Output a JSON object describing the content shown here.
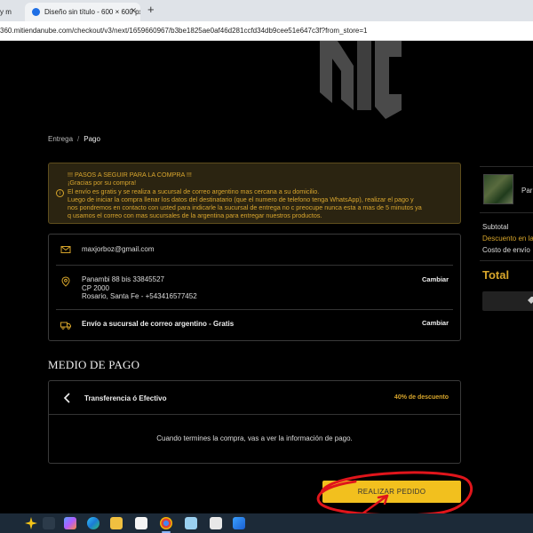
{
  "browser": {
    "tabs": [
      {
        "title": "y m"
      },
      {
        "title": "Diseño sin título - 600 × 600 px"
      }
    ],
    "new_tab": "+",
    "url": "360.mitiendanube.com/checkout/v3/next/1659660967/b3be1825ae0af46d281ccfd34db9cee51e647c3f?from_store=1"
  },
  "breadcrumb": {
    "step1": "Entrega",
    "separator": "/",
    "step2": "Pago"
  },
  "notice": {
    "lines": [
      "!!! PASOS A SEGUIR PARA LA COMPRA !!!",
      "¡Gracias por su compra!",
      "El envío es gratis y se realiza a sucursal de correo argentino mas cercana a su domicilio.",
      "Luego de iniciar la compra llenar los datos del destinatario (que el numero de telefono tenga WhatsApp), realizar el pago y",
      "nos pondremos en contacto con usted para indicarle la sucursal de entrega no c preocupe nunca esta a mas de 5 minutos ya",
      "q usamos el correo con mas sucursales de la argentina para entregar nuestros productos."
    ],
    "color": "#d9a62e"
  },
  "contact": {
    "email": "maxjorboz@gmail.com"
  },
  "address": {
    "line1": "Panambi 88 bis 33845527",
    "line2": "CP 2000",
    "line3": "Rosario, Santa Fe - +543416577452",
    "change_label": "Cambiar"
  },
  "shipping": {
    "label": "Envío a sucursal de correo argentino - Gratis",
    "change_label": "Cambiar"
  },
  "payment": {
    "title": "MEDIO DE PAGO",
    "method": "Transferencia ó Efectivo",
    "discount": "40% de descuento",
    "info": "Cuando termines la compra, vas a ver la información de pago."
  },
  "place_order": {
    "label": "REALIZAR PEDIDO",
    "color": "#f2c01e"
  },
  "summary": {
    "product_name": "Par",
    "subtotal_label": "Subtotal",
    "discount_label": "Descuento en la",
    "shipping_label": "Costo de envío",
    "total_label": "Total"
  },
  "icons": {
    "email": "mail-icon",
    "address": "location-pin-icon",
    "shipping": "truck-icon",
    "back": "chevron-left-icon",
    "info": "info-icon"
  }
}
